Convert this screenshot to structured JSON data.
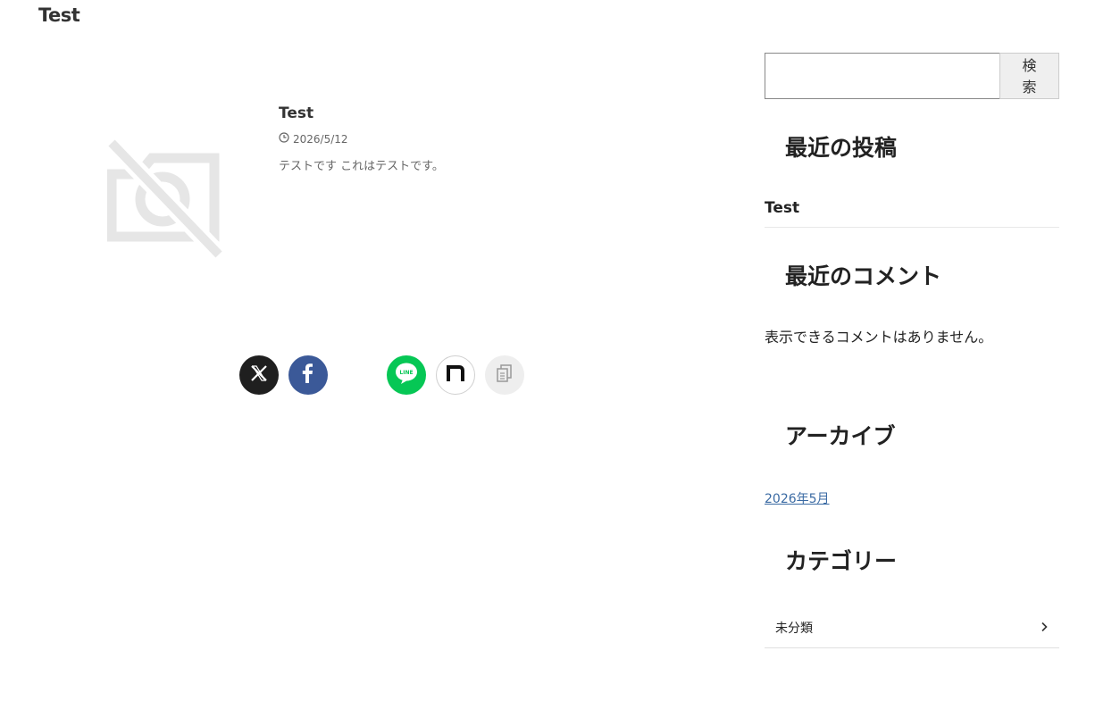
{
  "site": {
    "title": "Test"
  },
  "post": {
    "title": "Test",
    "date": "2026/5/12",
    "excerpt": "テストです これはテストです。",
    "thumbnail_icon": "no-image-icon"
  },
  "share": {
    "buttons": [
      {
        "name": "x",
        "icon": "x-icon",
        "color": "#1f1f1f"
      },
      {
        "name": "facebook",
        "icon": "facebook-icon",
        "color": "#3b5998"
      },
      {
        "name": "line",
        "icon": "line-icon",
        "color": "#06c755",
        "label": "LINE"
      },
      {
        "name": "note",
        "icon": "note-icon",
        "color": "#ffffff"
      },
      {
        "name": "copy",
        "icon": "copy-icon",
        "color": "#eeeeee"
      }
    ]
  },
  "sidebar": {
    "search": {
      "value": "",
      "placeholder": "",
      "button_label": "検索"
    },
    "recent_posts": {
      "title": "最近の投稿",
      "items": [
        "Test"
      ]
    },
    "recent_comments": {
      "title": "最近のコメント",
      "empty_text": "表示できるコメントはありません。"
    },
    "archives": {
      "title": "アーカイブ",
      "items": [
        "2026年5月"
      ]
    },
    "categories": {
      "title": "カテゴリー",
      "items": [
        "未分類"
      ]
    }
  },
  "colors": {
    "link": "#3a6aa3",
    "text": "#333333"
  }
}
